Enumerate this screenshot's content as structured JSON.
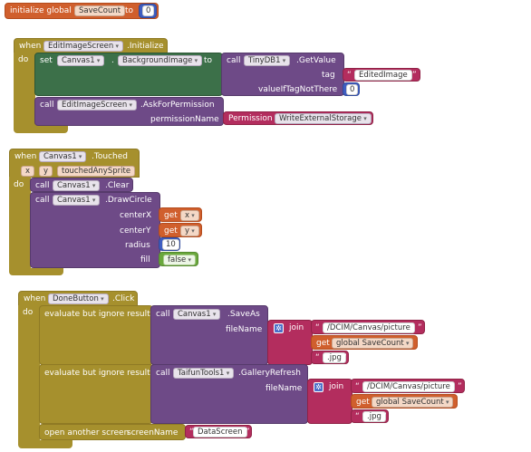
{
  "global_init": {
    "label": "initialize global",
    "var_name": "SaveCount",
    "to_label": "to",
    "value": "0"
  },
  "edit_init": {
    "when": "when",
    "component": "EditImageScreen",
    "event": ".Initialize",
    "do": "do",
    "set": {
      "label": "set",
      "component": "Canvas1",
      "property": "BackgroundImage",
      "to": "to"
    },
    "getvalue": {
      "call": "call",
      "component": "TinyDB1",
      "method": ".GetValue",
      "tag_label": "tag",
      "tag_value": "EditedImage",
      "notthere_label": "valueIfTagNotThere",
      "notthere_value": "0"
    },
    "ask": {
      "call": "call",
      "component": "EditImageScreen",
      "method": ".AskForPermission",
      "param_label": "permissionName",
      "perm_label": "Permission",
      "perm_value": "WriteExternalStorage"
    }
  },
  "canvas_touched": {
    "when": "when",
    "component": "Canvas1",
    "event": ".Touched",
    "params": [
      "x",
      "y",
      "touchedAnySprite"
    ],
    "do": "do",
    "clear": {
      "call": "call",
      "component": "Canvas1",
      "method": ".Clear"
    },
    "draw": {
      "call": "call",
      "component": "Canvas1",
      "method": ".DrawCircle",
      "cx_label": "centerX",
      "cy_label": "centerY",
      "radius_label": "radius",
      "fill_label": "fill",
      "get": "get",
      "cx_var": "x",
      "cy_var": "y",
      "radius": "10",
      "fill": "false"
    }
  },
  "done_click": {
    "when": "when",
    "component": "DoneButton",
    "event": ".Click",
    "do": "do",
    "eval_label": "evaluate but ignore result",
    "saveas": {
      "call": "call",
      "component": "Canvas1",
      "method": ".SaveAs",
      "param": "fileName",
      "join": "join",
      "text1": "/DCIM/Canvas/picture",
      "get": "get",
      "var": "global SaveCount",
      "text2": ".jpg"
    },
    "refresh": {
      "call": "call",
      "component": "TaifunTools1",
      "method": ".GalleryRefresh",
      "param": "fileName",
      "join": "join",
      "text1": "/DCIM/Canvas/picture",
      "get": "get",
      "var": "global SaveCount",
      "text2": ".jpg"
    },
    "open": {
      "label": "open another screen",
      "param": "screenName",
      "value": "DataScreen"
    }
  }
}
